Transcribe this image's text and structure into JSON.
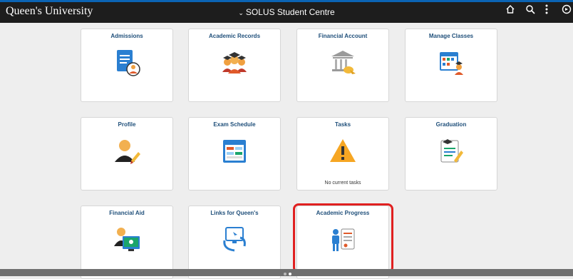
{
  "header": {
    "brand": "Queen's University",
    "title": "SOLUS Student Centre",
    "title_chevron": "⌄"
  },
  "tiles": [
    {
      "title": "Admissions",
      "icon": "admissions-icon"
    },
    {
      "title": "Academic Records",
      "icon": "graduates-icon"
    },
    {
      "title": "Financial Account",
      "icon": "bank-icon"
    },
    {
      "title": "Manage Classes",
      "icon": "calendar-student-icon"
    },
    {
      "title": "Profile",
      "icon": "profile-edit-icon"
    },
    {
      "title": "Exam Schedule",
      "icon": "calendar-icon"
    },
    {
      "title": "Tasks",
      "icon": "warning-icon",
      "subtitle": "No current tasks"
    },
    {
      "title": "Graduation",
      "icon": "graduation-document-icon"
    },
    {
      "title": "Financial Aid",
      "icon": "financial-aid-icon"
    },
    {
      "title": "Links for Queen's",
      "icon": "links-monitor-icon"
    },
    {
      "title": "Academic Progress",
      "icon": "academic-progress-icon"
    }
  ],
  "colors": {
    "topbar": "#1d1d1d",
    "tile_title": "#1f4f7a",
    "highlight": "#e02020"
  }
}
